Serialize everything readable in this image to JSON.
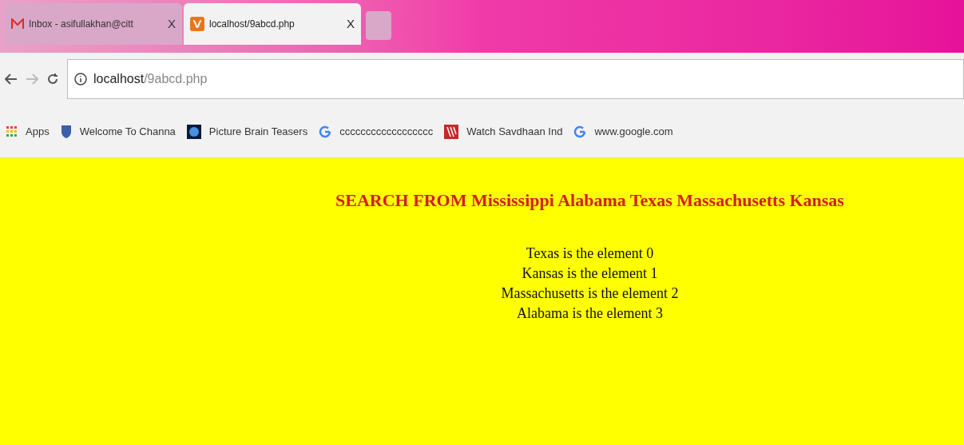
{
  "tabs": [
    {
      "title": "Inbox - asifullakhan@citt",
      "close": "X",
      "selected": false,
      "kind": "mail"
    },
    {
      "title": "localhost/9abcd.php",
      "close": "X",
      "selected": true,
      "kind": "server"
    }
  ],
  "address": {
    "host": "localhost",
    "path": "/9abcd.php"
  },
  "bookmarks": [
    {
      "label": "Apps",
      "kind": "apps"
    },
    {
      "label": "Welcome To Channa",
      "kind": "shield"
    },
    {
      "label": "Picture Brain Teasers",
      "kind": "globe"
    },
    {
      "label": "cccccccccccccccccc",
      "kind": "g"
    },
    {
      "label": "Watch Savdhaan Ind",
      "kind": "w"
    },
    {
      "label": "www.google.com",
      "kind": "g"
    }
  ],
  "page": {
    "heading": "SEARCH FROM Mississippi Alabama Texas Massachusetts Kansas",
    "lines": [
      "Texas is the element 0",
      "Kansas is the element 1",
      "Massachusetts is the element 2",
      "Alabama is the element 3"
    ]
  }
}
